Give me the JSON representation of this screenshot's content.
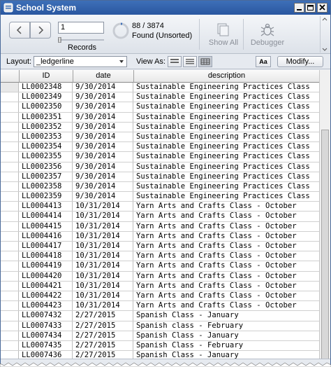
{
  "window": {
    "title": "School System"
  },
  "toolbar": {
    "record_value": "1",
    "records_label": "Records",
    "found_count": "88 / 3874",
    "found_status": "Found (Unsorted)",
    "show_all_label": "Show All",
    "debugger_label": "Debugger"
  },
  "layoutbar": {
    "layout_label": "Layout:",
    "layout_value": "_ledgerline",
    "view_as_label": "View As:",
    "aa_label": "Aa",
    "modify_label": "Modify..."
  },
  "table": {
    "columns": [
      "ID",
      "date",
      "description"
    ],
    "rows": [
      {
        "id": "LL0002348",
        "date": "9/30/2014",
        "desc": "Sustainable Engineering Practices Class"
      },
      {
        "id": "LL0002349",
        "date": "9/30/2014",
        "desc": "Sustainable Engineering Practices Class"
      },
      {
        "id": "LL0002350",
        "date": "9/30/2014",
        "desc": "Sustainable Engineering Practices Class"
      },
      {
        "id": "LL0002351",
        "date": "9/30/2014",
        "desc": "Sustainable Engineering Practices Class"
      },
      {
        "id": "LL0002352",
        "date": "9/30/2014",
        "desc": "Sustainable Engineering Practices Class"
      },
      {
        "id": "LL0002353",
        "date": "9/30/2014",
        "desc": "Sustainable Engineering Practices Class"
      },
      {
        "id": "LL0002354",
        "date": "9/30/2014",
        "desc": "Sustainable Engineering Practices Class"
      },
      {
        "id": "LL0002355",
        "date": "9/30/2014",
        "desc": "Sustainable Engineering Practices Class"
      },
      {
        "id": "LL0002356",
        "date": "9/30/2014",
        "desc": "Sustainable Engineering Practices Class"
      },
      {
        "id": "LL0002357",
        "date": "9/30/2014",
        "desc": "Sustainable Engineering Practices Class"
      },
      {
        "id": "LL0002358",
        "date": "9/30/2014",
        "desc": "Sustainable Engineering Practices Class"
      },
      {
        "id": "LL0002359",
        "date": "9/30/2014",
        "desc": "Sustainable Engineering Practices Class"
      },
      {
        "id": "LL0004413",
        "date": "10/31/2014",
        "desc": "Yarn Arts and Crafts Class - October"
      },
      {
        "id": "LL0004414",
        "date": "10/31/2014",
        "desc": "Yarn Arts and Crafts Class - October"
      },
      {
        "id": "LL0004415",
        "date": "10/31/2014",
        "desc": "Yarn Arts and Crafts Class - October"
      },
      {
        "id": "LL0004416",
        "date": "10/31/2014",
        "desc": "Yarn Arts and Crafts Class - October"
      },
      {
        "id": "LL0004417",
        "date": "10/31/2014",
        "desc": "Yarn Arts and Crafts Class - October"
      },
      {
        "id": "LL0004418",
        "date": "10/31/2014",
        "desc": "Yarn Arts and Crafts Class - October"
      },
      {
        "id": "LL0004419",
        "date": "10/31/2014",
        "desc": "Yarn Arts and Crafts Class - October"
      },
      {
        "id": "LL0004420",
        "date": "10/31/2014",
        "desc": "Yarn Arts and Crafts Class - October"
      },
      {
        "id": "LL0004421",
        "date": "10/31/2014",
        "desc": "Yarn Arts and Crafts Class - October"
      },
      {
        "id": "LL0004422",
        "date": "10/31/2014",
        "desc": "Yarn Arts and Crafts Class - October"
      },
      {
        "id": "LL0004423",
        "date": "10/31/2014",
        "desc": "Yarn Arts and Crafts Class - October"
      },
      {
        "id": "LL0007432",
        "date": "2/27/2015",
        "desc": "Spanish Class - January"
      },
      {
        "id": "LL0007433",
        "date": "2/27/2015",
        "desc": "Spanish class - February"
      },
      {
        "id": "LL0007434",
        "date": "2/27/2015",
        "desc": "Spanish Class - January"
      },
      {
        "id": "LL0007435",
        "date": "2/27/2015",
        "desc": "Spanish Class - February"
      },
      {
        "id": "LL0007436",
        "date": "2/27/2015",
        "desc": "Spanish Class - January"
      }
    ]
  }
}
